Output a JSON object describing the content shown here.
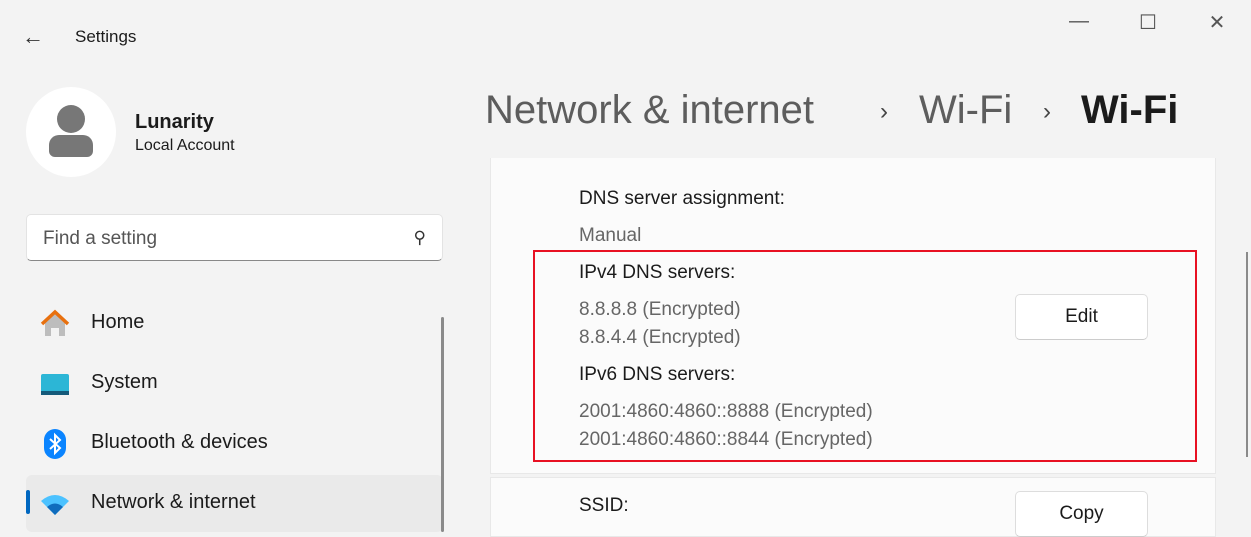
{
  "window": {
    "title": "Settings",
    "minimize": "—",
    "maximize": "☐",
    "close": "✕",
    "back": "←"
  },
  "user": {
    "name": "Lunarity",
    "account_type": "Local Account"
  },
  "search": {
    "placeholder": "Find a setting",
    "icon": "search-icon"
  },
  "sidebar": {
    "items": [
      {
        "label": "Home",
        "icon": "home-icon"
      },
      {
        "label": "System",
        "icon": "system-icon"
      },
      {
        "label": "Bluetooth & devices",
        "icon": "bluetooth-icon"
      },
      {
        "label": "Network & internet",
        "icon": "wifi-icon",
        "selected": true
      }
    ]
  },
  "breadcrumb": {
    "items": [
      "Network & internet",
      "Wi-Fi",
      "Wi-Fi"
    ],
    "separator": "›"
  },
  "details": {
    "dns_assignment_label": "DNS server assignment:",
    "dns_assignment_value": "Manual",
    "ipv4_label": "IPv4 DNS servers:",
    "ipv4_values": [
      "8.8.8.8 (Encrypted)",
      "8.8.4.4 (Encrypted)"
    ],
    "ipv6_label": "IPv6 DNS servers:",
    "ipv6_values": [
      "2001:4860:4860::8888 (Encrypted)",
      "2001:4860:4860::8844 (Encrypted)"
    ],
    "edit_label": "Edit",
    "ssid_label": "SSID:",
    "copy_label": "Copy"
  },
  "colors": {
    "accent": "#0067c0",
    "highlight": "#e81123"
  }
}
